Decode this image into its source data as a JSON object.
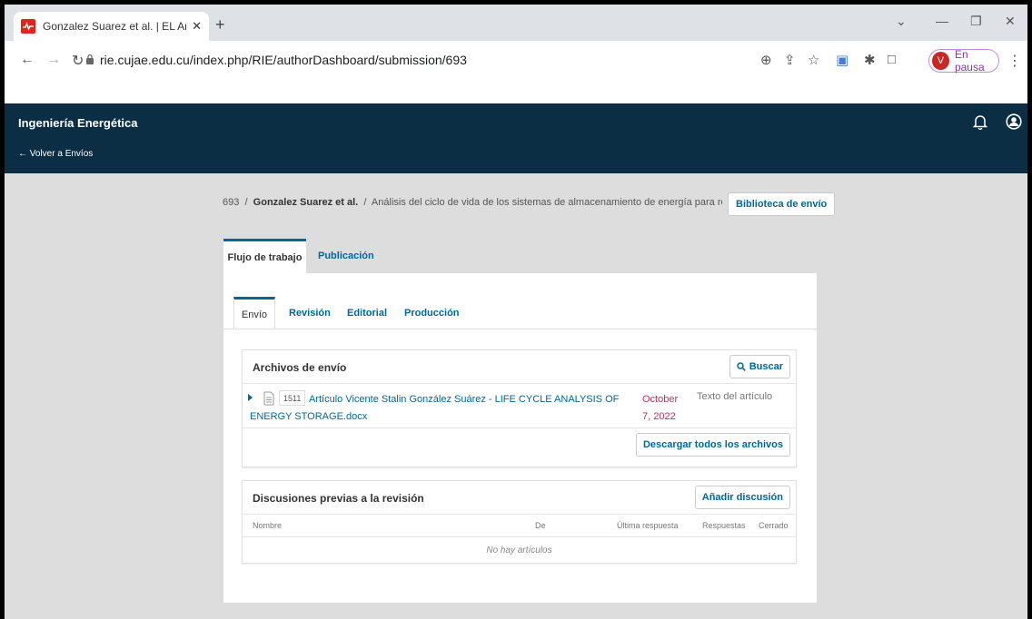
{
  "browser": {
    "tab_title": "Gonzalez Suarez et al. | EL Análisis",
    "tab_close": "✕",
    "new_tab": "+",
    "url": "rie.cujae.edu.cu/index.php/RIE/authorDashboard/submission/693",
    "profile_initial": "V",
    "profile_status": "En pausa",
    "favicon_color": "#e2231a"
  },
  "header": {
    "journal": "Ingeniería Energética",
    "back_link": "← Volver a Envíos",
    "bg_color": "#0b2e45"
  },
  "breadcrumb": {
    "id": "693",
    "sep": "/",
    "authors": "Gonzalez Suarez et al.",
    "title": "Análisis del ciclo de vida de los sistemas de almacenamiento de energía para redes inteligentes"
  },
  "library_button": "Biblioteca de envío",
  "main_tabs": {
    "workflow": "Flujo de trabajo",
    "publication": "Publicación"
  },
  "stage_tabs": {
    "submission": "Envío",
    "review": "Revisión",
    "editorial": "Editorial",
    "production": "Producción"
  },
  "files": {
    "title": "Archivos de envío",
    "search_label": "Buscar",
    "file_id": "1511",
    "file_name": "Artículo Vicente Stalin González Suárez - LIFE CYCLE ANALYSIS OF ENERGY STORAGE.docx",
    "file_date": "October 7, 2022",
    "file_type": "Texto del artículo",
    "download_all": "Descargar todos los archivos"
  },
  "discussions": {
    "title": "Discusiones previas a la revisión",
    "add_label": "Añadir discusión",
    "columns": {
      "name": "Nombre",
      "from": "De",
      "last_reply": "Última respuesta",
      "replies": "Respuestas",
      "closed": "Cerrado"
    },
    "empty": "No hay artículos"
  },
  "accent_color": "#006798"
}
